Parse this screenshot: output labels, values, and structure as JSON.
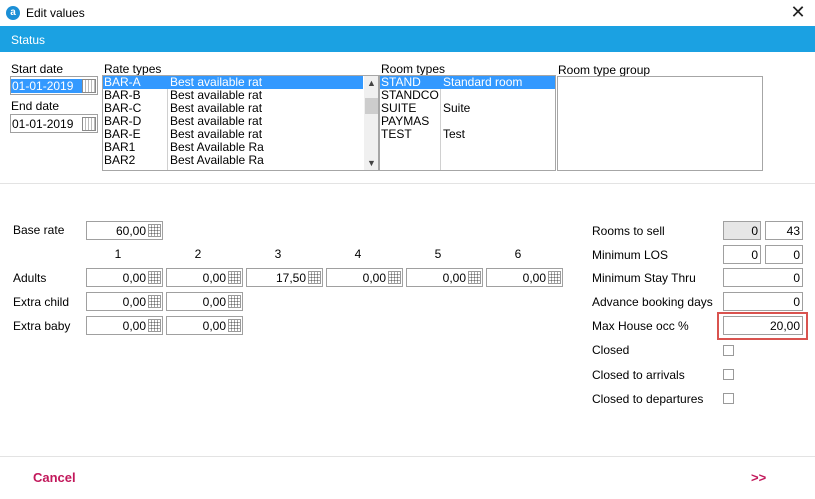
{
  "window": {
    "title": "Edit values",
    "app_icon_letter": "a",
    "close_glyph": "✕"
  },
  "status": {
    "label": "Status"
  },
  "dates": {
    "start_label": "Start date",
    "start_value": "01-01-2019",
    "end_label": "End date",
    "end_value": "01-01-2019"
  },
  "rate_types": {
    "label": "Rate types",
    "rows": [
      {
        "code": "BAR-A",
        "name": "Best available rat"
      },
      {
        "code": "BAR-B",
        "name": "Best available rat"
      },
      {
        "code": "BAR-C",
        "name": "Best available rat"
      },
      {
        "code": "BAR-D",
        "name": "Best available rat"
      },
      {
        "code": "BAR-E",
        "name": "Best available rat"
      },
      {
        "code": "BAR1",
        "name": "Best Available Ra"
      },
      {
        "code": "BAR2",
        "name": "Best Available Ra"
      }
    ]
  },
  "room_types": {
    "label": "Room types",
    "rows": [
      {
        "code": "STAND",
        "name": "Standard room"
      },
      {
        "code": "STANDCO",
        "name": ""
      },
      {
        "code": "SUITE",
        "name": "Suite"
      },
      {
        "code": "PAYMAS",
        "name": ""
      },
      {
        "code": "TEST",
        "name": "Test"
      }
    ]
  },
  "room_type_group": {
    "label": "Room type group"
  },
  "rates": {
    "base_label": "Base rate",
    "base_value": "60,00",
    "columns": [
      "1",
      "2",
      "3",
      "4",
      "5",
      "6"
    ],
    "adults_label": "Adults",
    "adults": [
      "0,00",
      "0,00",
      "17,50",
      "0,00",
      "0,00",
      "0,00"
    ],
    "extra_child_label": "Extra child",
    "extra_child": [
      "0,00",
      "0,00"
    ],
    "extra_baby_label": "Extra baby",
    "extra_baby": [
      "0,00",
      "0,00"
    ]
  },
  "restrictions": {
    "rooms_to_sell_label": "Rooms to sell",
    "rooms_to_sell_a": "0",
    "rooms_to_sell_b": "43",
    "min_los_label": "Minimum LOS",
    "min_los_a": "0",
    "min_los_b": "0",
    "min_stay_thru_label": "Minimum Stay Thru",
    "min_stay_thru": "0",
    "advance_booking_label": "Advance booking days",
    "advance_booking": "0",
    "max_house_occ_label": "Max House occ %",
    "max_house_occ": "20,00",
    "closed_label": "Closed",
    "closed_arrivals_label": "Closed to arrivals",
    "closed_departures_label": "Closed to departures"
  },
  "footer": {
    "cancel_label": "Cancel",
    "next_label": ">>"
  },
  "colors": {
    "status_bar": "#1ba1e2",
    "accent": "#c2185b",
    "selection": "#3399ff",
    "highlight": "#d9534f"
  }
}
